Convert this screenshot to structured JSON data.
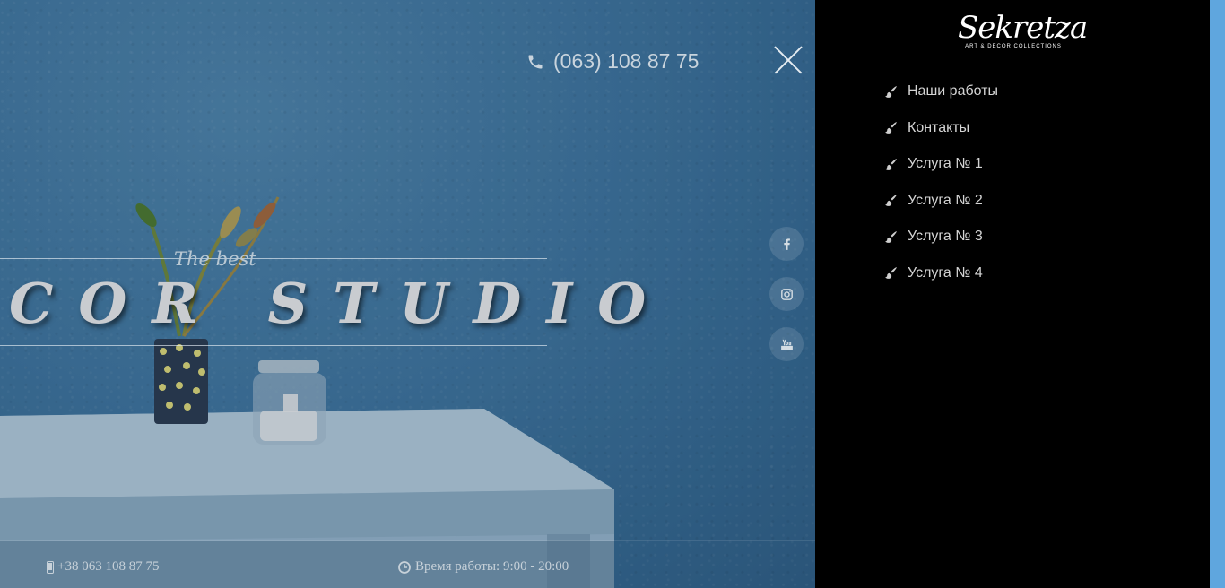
{
  "hero": {
    "phone": "(063) 108 87 75",
    "tagline": "The best",
    "title": "COR STUDIO"
  },
  "social": [
    {
      "icon": "facebook-icon"
    },
    {
      "icon": "instagram-icon"
    },
    {
      "icon": "youtube-icon"
    }
  ],
  "footer": {
    "phone": "+38 063 108 87 75",
    "hours": "Время работы: 9:00 - 20:00"
  },
  "logo": {
    "name": "Sekretza",
    "subtitle": "ART & DECOR COLLECTIONS"
  },
  "menu": {
    "items": [
      {
        "label": "Наши работы"
      },
      {
        "label": "Контакты"
      },
      {
        "label": "Услуга № 1"
      },
      {
        "label": "Услуга № 2"
      },
      {
        "label": "Услуга № 3"
      },
      {
        "label": "Услуга № 4"
      }
    ]
  },
  "colors": {
    "accent_strip": "#5fa6de",
    "menu_bg": "#000000",
    "hero_blue": "#3f76a0"
  }
}
